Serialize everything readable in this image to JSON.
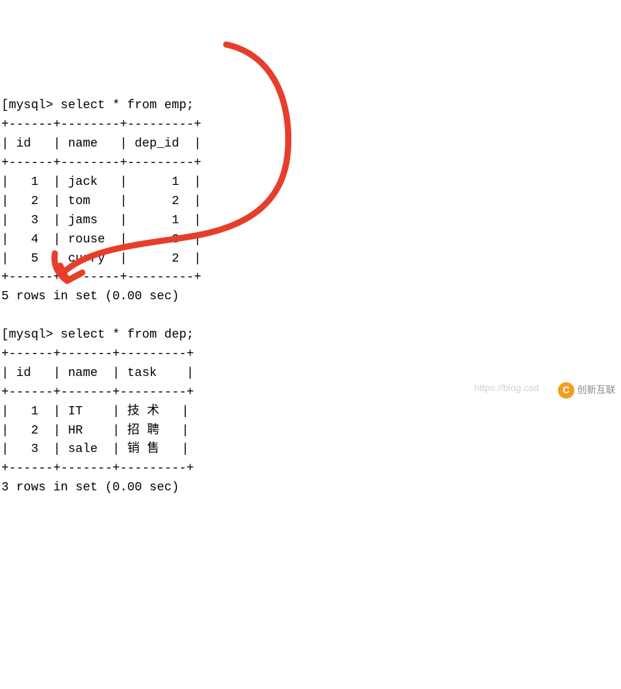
{
  "prompt": "[mysql> ",
  "query1": {
    "sql": "select * from emp;",
    "border_top": "+------+--------+---------+",
    "header_line": "| id   | name   | dep_id  |",
    "border_mid": "+------+--------+---------+",
    "rows": [
      "|   1  | jack   |      1  |",
      "|   2  | tom    |      2  |",
      "|   3  | jams   |      1  |",
      "|   4  | rouse  |      3  |",
      "|   5  | curry  |      2  |"
    ],
    "border_bot": "+------+--------+---------+",
    "footer": "5 rows in set (0.00 sec)"
  },
  "query2": {
    "sql": "select * from dep;",
    "border_top": "+------+-------+---------+",
    "header_line": "| id   | name  | task    |",
    "border_mid": "+------+-------+---------+",
    "rows": [
      "|   1  | IT    | 技 术   |",
      "|   2  | HR    | 招 聘   |",
      "|   3  | sale  | 销 售   |"
    ],
    "border_bot": "+------+-------+---------+",
    "footer": "3 rows in set (0.00 sec)"
  },
  "chart_data": {
    "type": "table",
    "tables": [
      {
        "name": "emp",
        "columns": [
          "id",
          "name",
          "dep_id"
        ],
        "rows": [
          [
            1,
            "jack",
            1
          ],
          [
            2,
            "tom",
            2
          ],
          [
            3,
            "jams",
            1
          ],
          [
            4,
            "rouse",
            3
          ],
          [
            5,
            "curry",
            2
          ]
        ],
        "row_count": 5,
        "elapsed_sec": 0.0
      },
      {
        "name": "dep",
        "columns": [
          "id",
          "name",
          "task"
        ],
        "rows": [
          [
            1,
            "IT",
            "技术"
          ],
          [
            2,
            "HR",
            "招聘"
          ],
          [
            3,
            "sale",
            "销售"
          ]
        ],
        "row_count": 3,
        "elapsed_sec": 0.0
      }
    ],
    "annotation": "red hand-drawn arrow linking emp.dep_id column header to dep.id column header"
  },
  "watermark": {
    "url": "https://blog.csd",
    "brand": "创新互联"
  }
}
